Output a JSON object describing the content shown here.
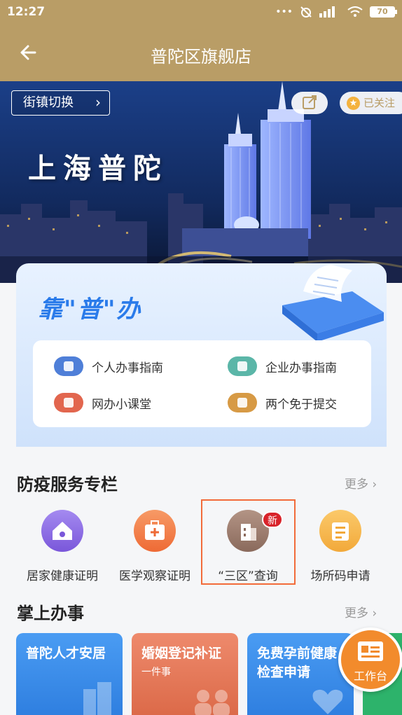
{
  "status": {
    "time": "12:27",
    "battery": "70",
    "icons": [
      "more-dots-icon",
      "mute-alarm-icon",
      "signal-icon",
      "wifi-icon",
      "battery-icon"
    ]
  },
  "header": {
    "title": "普陀区旗舰店"
  },
  "banner": {
    "switch_label": "街镇切换",
    "follow_label": "已关注",
    "title": "上海普陀"
  },
  "kpb": {
    "title": "靠\"普\"办",
    "items": [
      {
        "label": "个人办事指南",
        "icon": "person-icon",
        "color": "#4f7fd8"
      },
      {
        "label": "企业办事指南",
        "icon": "building-icon",
        "color": "#5bb6a8"
      },
      {
        "label": "网办小课堂",
        "icon": "graduation-cap-icon",
        "color": "#e2664e"
      },
      {
        "label": "两个免于提交",
        "icon": "hand-icon",
        "color": "#d79a45"
      }
    ]
  },
  "epidemic": {
    "title": "防疫服务专栏",
    "more": "更多",
    "items": [
      {
        "label": "居家健康证明",
        "icon": "house-icon",
        "color": "#8b6be3"
      },
      {
        "label": "医学观察证明",
        "icon": "medical-kit-icon",
        "color": "#f17a46"
      },
      {
        "label": "“三区”查询",
        "icon": "building-icon",
        "color": "#9b7a6b",
        "badge": "新"
      },
      {
        "label": "场所码申请",
        "icon": "qr-card-icon",
        "color": "#f4b23e"
      }
    ]
  },
  "handheld": {
    "title": "掌上办事",
    "more": "更多",
    "tiles": [
      {
        "title": "普陀人才安居",
        "subtitle": "",
        "color": "#3a8de8"
      },
      {
        "title": "婚姻登记补证",
        "subtitle": "一件事",
        "color": "#e2775a"
      },
      {
        "title": "免费孕前健康",
        "subtitle": "检查申请",
        "color": "#3a8de8"
      }
    ]
  },
  "workbench": {
    "label": "工作台"
  }
}
